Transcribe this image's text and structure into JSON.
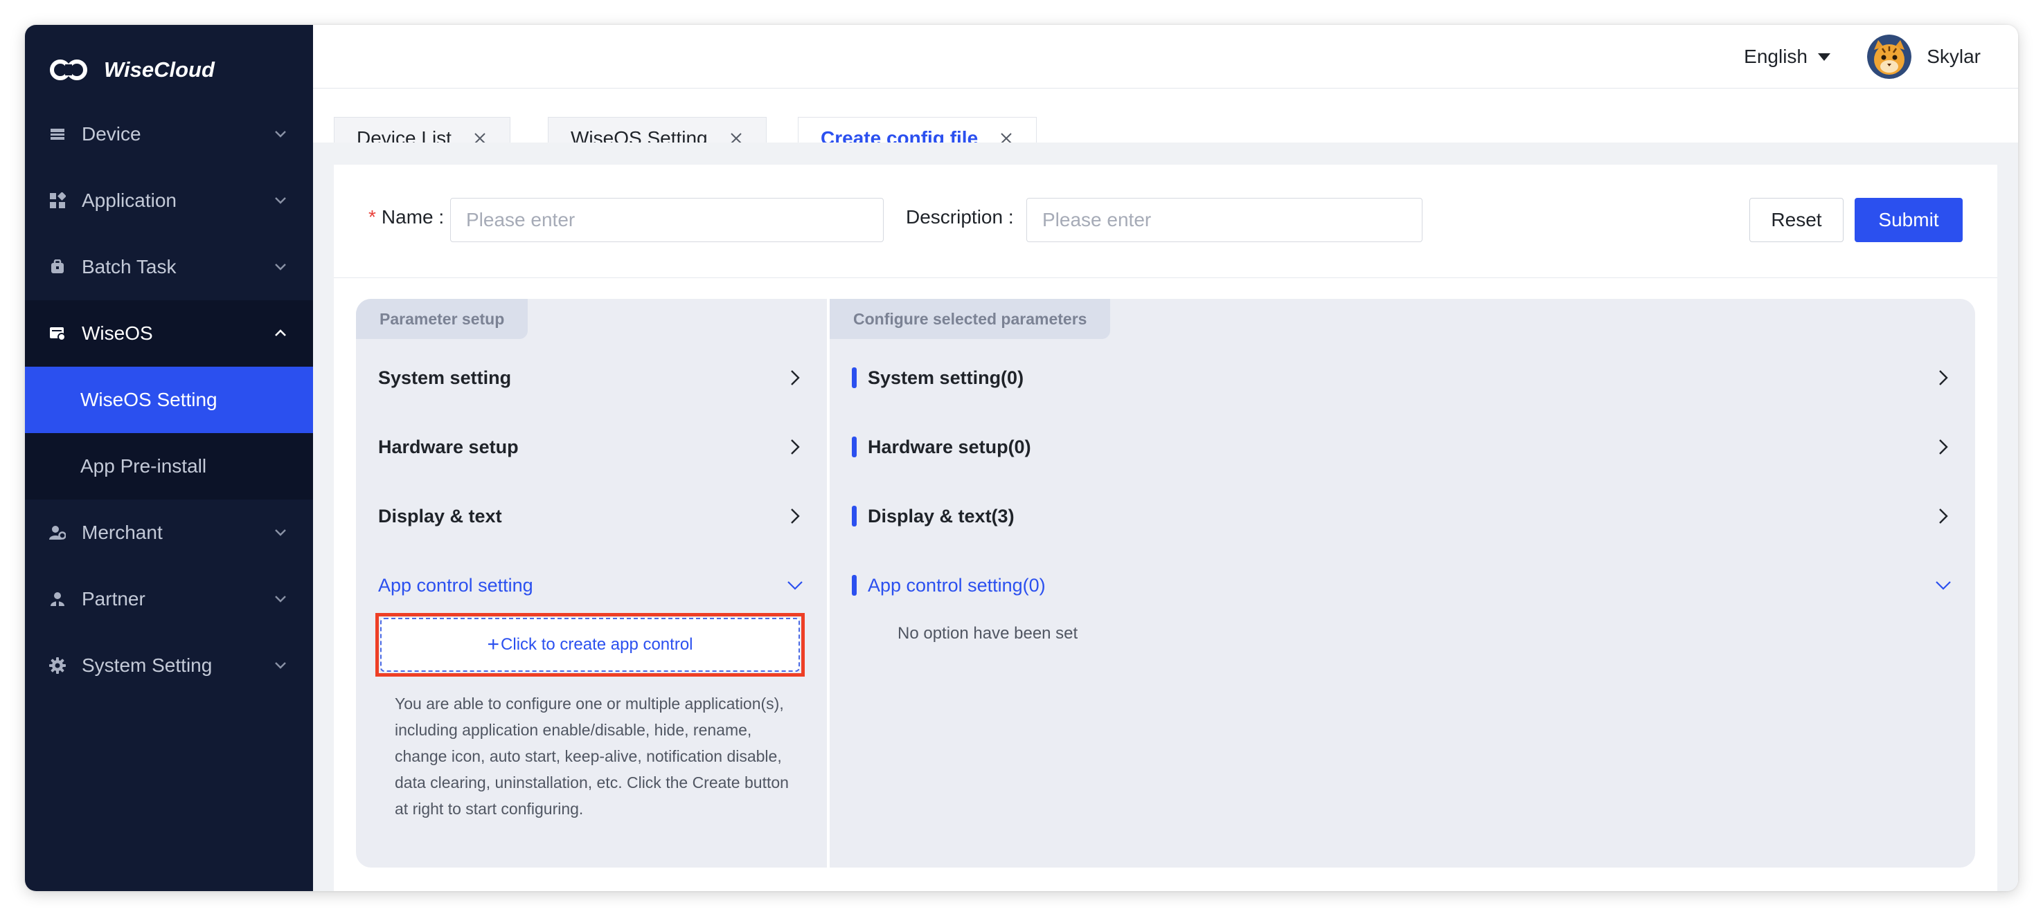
{
  "brand": {
    "name": "WiseCloud"
  },
  "sidebar": {
    "items": [
      {
        "label": "Device",
        "icon": "device-icon"
      },
      {
        "label": "Application",
        "icon": "application-icon"
      },
      {
        "label": "Batch Task",
        "icon": "batch-task-icon"
      },
      {
        "label": "WiseOS",
        "icon": "wiseos-icon"
      },
      {
        "label": "Merchant",
        "icon": "merchant-icon"
      },
      {
        "label": "Partner",
        "icon": "partner-icon"
      },
      {
        "label": "System Setting",
        "icon": "gear-icon"
      }
    ],
    "wiseos_sub": [
      {
        "label": "WiseOS Setting"
      },
      {
        "label": "App Pre-install"
      }
    ]
  },
  "header": {
    "language": "English",
    "username": "Skylar"
  },
  "tabs": [
    {
      "label": "Device List"
    },
    {
      "label": "WiseOS Setting"
    },
    {
      "label": "Create config file"
    }
  ],
  "form": {
    "name_label": "Name",
    "name_placeholder": "Please enter",
    "description_label": "Description",
    "description_placeholder": "Please enter",
    "reset_label": "Reset",
    "submit_label": "Submit"
  },
  "parameter_setup": {
    "title": "Parameter setup",
    "items": [
      {
        "label": "System setting"
      },
      {
        "label": "Hardware setup"
      },
      {
        "label": "Display & text"
      },
      {
        "label": "App control setting"
      }
    ],
    "create_label": "Click to create app control",
    "help_text": "You are able to configure one or multiple application(s), including application enable/disable, hide, rename, change icon, auto start, keep-alive, notification disable, data clearing, uninstallation, etc. Click the Create button at right to start configuring."
  },
  "configured": {
    "title": "Configure selected parameters",
    "items": [
      {
        "label": "System setting(0)"
      },
      {
        "label": "Hardware setup(0)"
      },
      {
        "label": "Display & text(3)"
      },
      {
        "label": "App control setting(0)"
      }
    ],
    "empty_text": "No option have been set"
  },
  "colors": {
    "primary": "#2b50ef",
    "sidebar_bg": "#111a33",
    "highlight_border": "#ee3f25"
  }
}
